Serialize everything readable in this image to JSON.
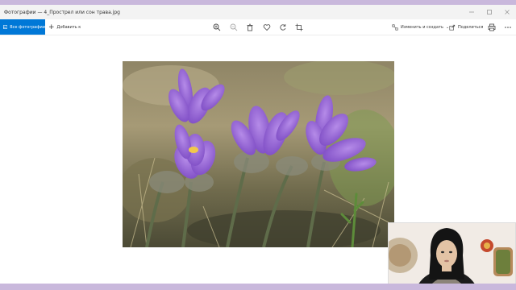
{
  "window": {
    "title": "Фотографии — 4_Прострел или сон трава.jpg"
  },
  "toolbar": {
    "all_photos_label": "Все фотографии",
    "add_label": "Добавить к",
    "edit_create_label": "Изменить и создать",
    "share_label": "Поделиться",
    "tools": [
      "zoom-in-icon",
      "zoom-out-icon",
      "delete-icon",
      "favorite-icon",
      "rotate-icon",
      "crop-icon",
      "print-icon",
      "more-icon"
    ]
  },
  "photo": {
    "subject": "pasque flowers"
  },
  "colors": {
    "accent": "#0078d7",
    "frame": "#c9b8dc",
    "flower": "#8e5fd4"
  }
}
